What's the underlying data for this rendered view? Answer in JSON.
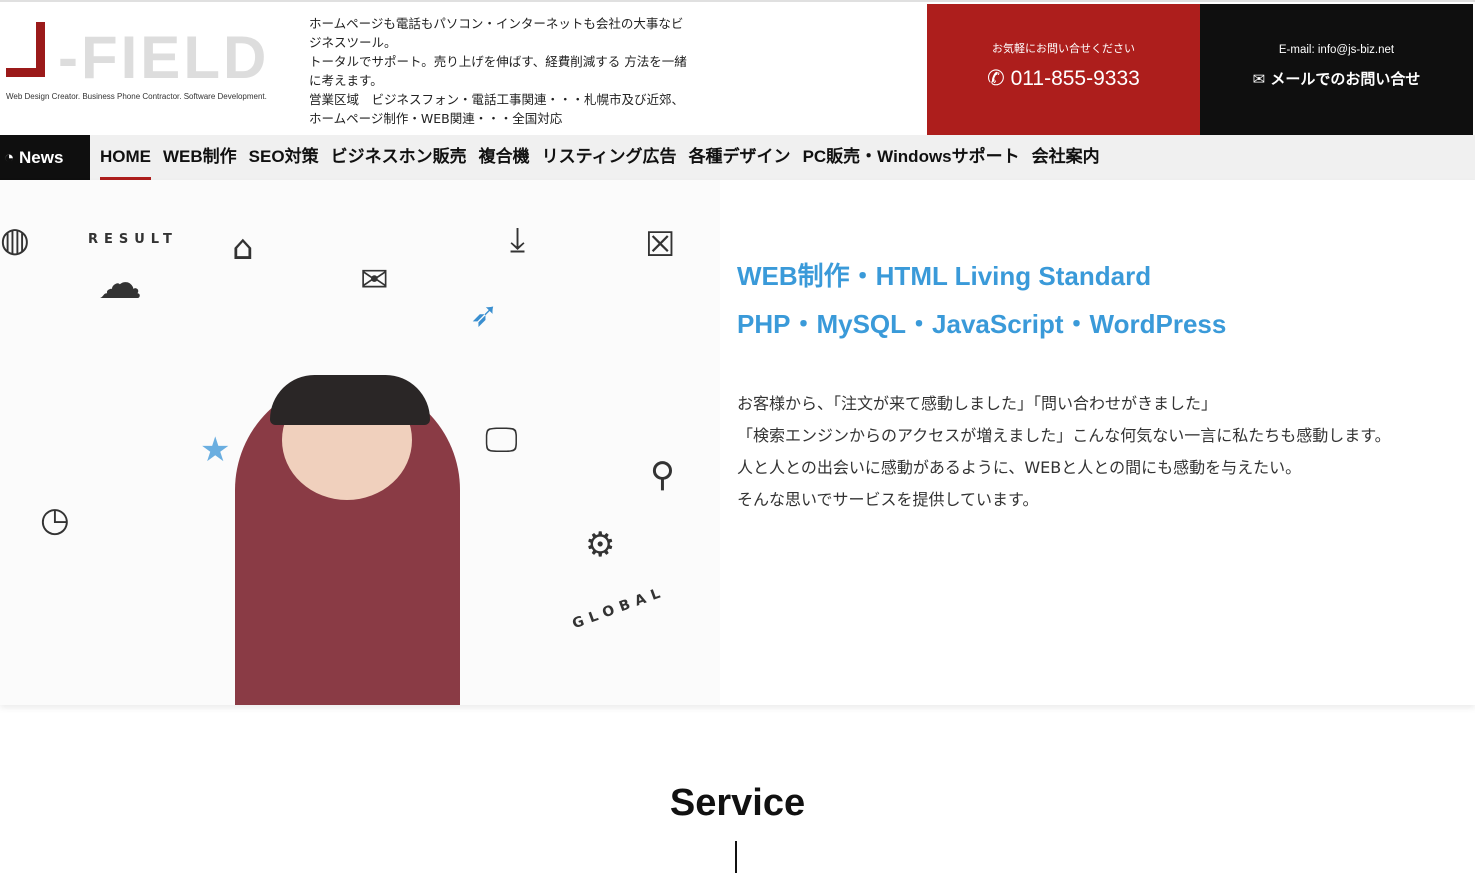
{
  "logo": {
    "text": "J-FIELD",
    "tagline": "Web Design Creator.  Business Phone Contractor.  Software Development."
  },
  "intro": [
    "ホームページも電話もパソコン・インターネットも会社の大事なビジネスツール。",
    "トータルでサポート。売り上げを伸ばす、経費削減する 方法を一緒に考えます。",
    "営業区域　ビジネスフォン・電話工事関連・・・札幌市及び近郊、ホームページ制作・WEB関連・・・全国対応"
  ],
  "contact": {
    "tel_caption": "お気軽にお問い合せください",
    "tel": "011-855-9333",
    "email_caption": "E-mail: info@js-biz.net",
    "email_button": "メールでのお問い合せ"
  },
  "nav": {
    "news": "News",
    "items": [
      "HOME",
      "WEB制作",
      "SEO対策",
      "ビジネスホン販売",
      "複合機",
      "リスティング広告",
      "各種デザイン",
      "PC販売・Windowsサポート",
      "会社案内"
    ]
  },
  "hero": {
    "image_words": [
      "RESULT",
      "GLOBAL"
    ],
    "headings": [
      "WEB制作・HTML Living Standard",
      "PHP・MySQL・JavaScript・WordPress"
    ],
    "paragraphs": [
      "お客様から、「注文が来て感動しました」「問い合わせがきました」",
      "「検索エンジンからのアクセスが増えました」こんな何気ない一言に私たちも感動します。",
      "人と人との出会いに感動があるように、WEBと人との間にも感動を与えたい。",
      "そんな思いでサービスを提供しています。"
    ]
  },
  "section": {
    "title": "Service"
  },
  "colors": {
    "brand_red": "#ad1e1c",
    "dark": "#0f0f0f",
    "accent_blue": "#3a9ad9"
  }
}
